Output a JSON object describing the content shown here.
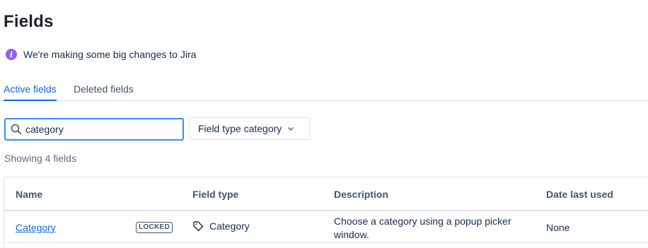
{
  "page": {
    "title": "Fields"
  },
  "banner": {
    "icon": "info-icon",
    "text": "We're making some big changes to Jira",
    "icon_color": "#8f5ff0"
  },
  "tabs": [
    {
      "label": "Active fields",
      "active": true
    },
    {
      "label": "Deleted fields",
      "active": false
    }
  ],
  "search": {
    "value": "category",
    "icon": "search-icon"
  },
  "filter": {
    "label": "Field type category",
    "icon": "chevron-down-icon"
  },
  "results": {
    "summary": "Showing 4 fields"
  },
  "table": {
    "headers": [
      "Name",
      "Field type",
      "Description",
      "Date last used"
    ],
    "rows": [
      {
        "name": "Category",
        "badge": "LOCKED",
        "type_icon": "tag-icon",
        "type": "Category",
        "description": "Choose a category using a popup picker window.",
        "last_used": "None"
      }
    ]
  },
  "colors": {
    "accent": "#0c66e4",
    "focus_border": "#388bff",
    "border": "#dfe1e6"
  }
}
